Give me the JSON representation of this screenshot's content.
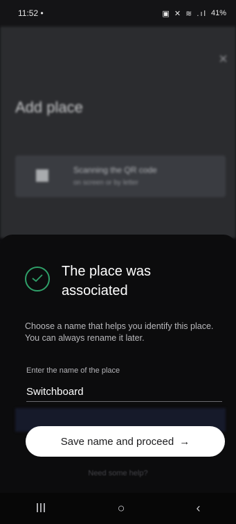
{
  "status_bar": {
    "time": "11:52",
    "dot": "•",
    "icons": "▣ ✕ ≋ .ıl",
    "battery": "41%"
  },
  "background_screen": {
    "close_glyph": "×",
    "title": "Add place",
    "scan_card": {
      "title": "Scanning the QR code",
      "subtitle": "on screen or by letter"
    },
    "help_link": "Need some help?"
  },
  "sheet": {
    "title": "The place was associated",
    "description": "Choose a name that helps you identify this place. You can always rename it later.",
    "field": {
      "label": "Enter the name of the place",
      "value": "Switchboard"
    },
    "save_button": {
      "label": "Save name and proceed",
      "icon": "→"
    },
    "accent_color": "#2fa069"
  },
  "nav_bar": {
    "recents": "III",
    "home": "○",
    "back": "‹"
  }
}
